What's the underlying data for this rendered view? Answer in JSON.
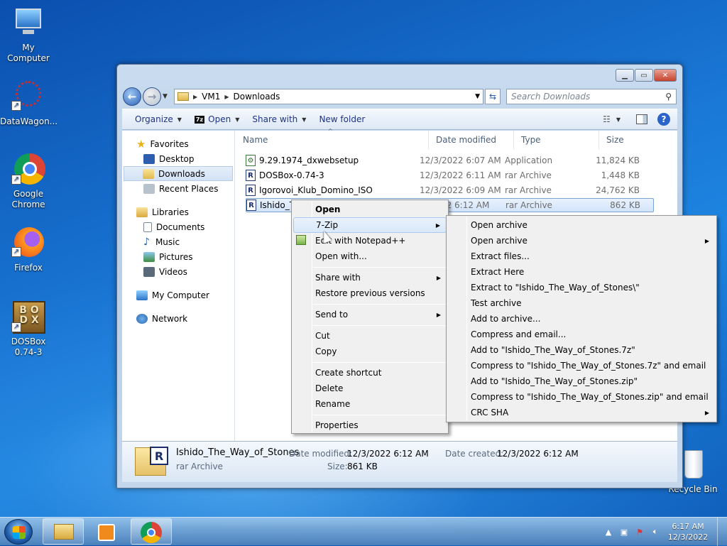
{
  "desktop": {
    "icons": [
      {
        "label": "My Computer"
      },
      {
        "label": "DataWagon..."
      },
      {
        "label": "Google Chrome"
      },
      {
        "label": "Firefox"
      },
      {
        "label": "DOSBox 0.74-3"
      },
      {
        "label": "Recycle Bin"
      }
    ]
  },
  "window": {
    "breadcrumb": [
      "VM1",
      "Downloads"
    ],
    "search_placeholder": "Search Downloads",
    "toolbar": {
      "organize": "Organize",
      "open": "Open",
      "share_with": "Share with",
      "new_folder": "New folder"
    },
    "nav": {
      "favorites": "Favorites",
      "desktop": "Desktop",
      "downloads": "Downloads",
      "recent_places": "Recent Places",
      "libraries": "Libraries",
      "documents": "Documents",
      "music": "Music",
      "pictures": "Pictures",
      "videos": "Videos",
      "my_computer": "My Computer",
      "network": "Network"
    },
    "columns": {
      "name": "Name",
      "date": "Date modified",
      "type": "Type",
      "size": "Size"
    },
    "files": [
      {
        "name": "9.29.1974_dxwebsetup",
        "date": "12/3/2022 6:07 AM",
        "type": "Application",
        "size": "11,824 KB"
      },
      {
        "name": "DOSBox-0.74-3",
        "date": "12/3/2022 6:11 AM",
        "type": "rar Archive",
        "size": "1,448 KB"
      },
      {
        "name": "Igorovoi_Klub_Domino_ISO",
        "date": "12/3/2022 6:09 AM",
        "type": "rar Archive",
        "size": "24,762 KB"
      },
      {
        "name": "Ishido_T",
        "date": "2/2022 6:12 AM",
        "type": "rar Archive",
        "size": "862 KB"
      }
    ],
    "details": {
      "name": "Ishido_The_Way_of_Stones",
      "type": "rar Archive",
      "date_modified_label": "Date modified:",
      "date_modified": "12/3/2022 6:12 AM",
      "date_created_label": "Date created:",
      "date_created": "12/3/2022 6:12 AM",
      "size_label": "Size:",
      "size": "861 KB"
    }
  },
  "context_menu": {
    "open": "Open",
    "seven_zip": "7-Zip",
    "edit_notepad": "Edit with Notepad++",
    "open_with": "Open with...",
    "share_with": "Share with",
    "restore": "Restore previous versions",
    "send_to": "Send to",
    "cut": "Cut",
    "copy": "Copy",
    "create_shortcut": "Create shortcut",
    "delete": "Delete",
    "rename": "Rename",
    "properties": "Properties"
  },
  "submenu": {
    "items": [
      "Open archive",
      "Open archive",
      "Extract files...",
      "Extract Here",
      "Extract to \"Ishido_The_Way_of_Stones\\\"",
      "Test archive",
      "Add to archive...",
      "Compress and email...",
      "Add to \"Ishido_The_Way_of_Stones.7z\"",
      "Compress to \"Ishido_The_Way_of_Stones.7z\" and email",
      "Add to \"Ishido_The_Way_of_Stones.zip\"",
      "Compress to \"Ishido_The_Way_of_Stones.zip\" and email",
      "CRC SHA"
    ]
  },
  "taskbar": {
    "time": "6:17 AM",
    "date": "12/3/2022"
  }
}
